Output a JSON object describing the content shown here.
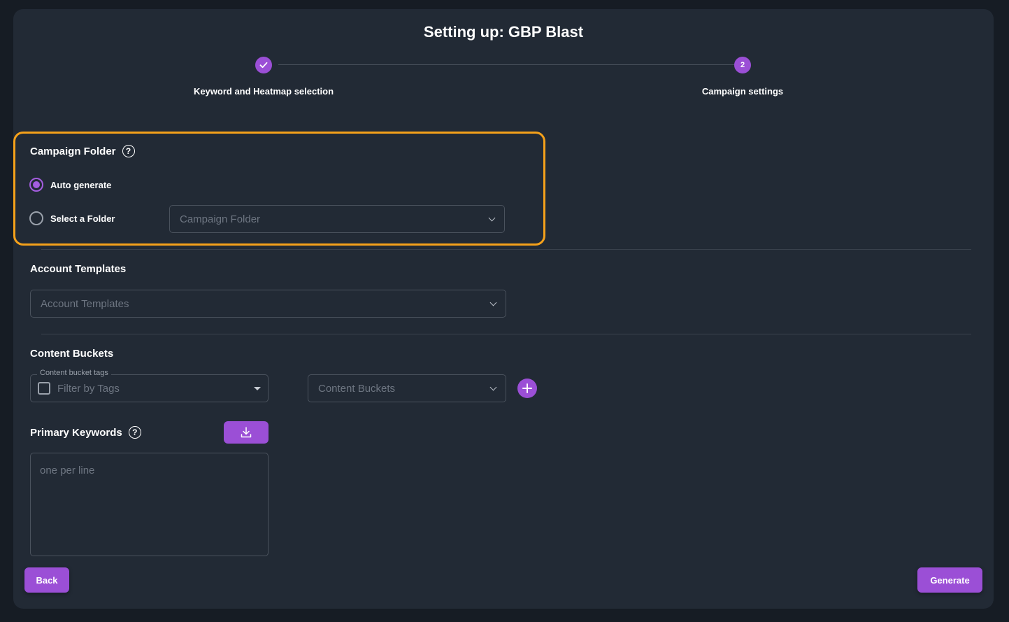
{
  "page": {
    "title": "Setting up: GBP Blast"
  },
  "stepper": {
    "steps": [
      {
        "label": "Keyword and Heatmap selection",
        "status": "completed",
        "icon": "check-icon"
      },
      {
        "label": "Campaign settings",
        "number": "2",
        "status": "active"
      }
    ]
  },
  "campaign_folder": {
    "title": "Campaign Folder",
    "options": [
      {
        "label": "Auto generate",
        "selected": true
      },
      {
        "label": "Select a Folder",
        "selected": false
      }
    ],
    "select_placeholder": "Campaign Folder"
  },
  "account_templates": {
    "title": "Account Templates",
    "select_placeholder": "Account Templates"
  },
  "content_buckets": {
    "title": "Content Buckets",
    "tags_legend": "Content bucket tags",
    "tags_placeholder": "Filter by Tags",
    "select_placeholder": "Content Buckets"
  },
  "primary_keywords": {
    "title": "Primary Keywords",
    "placeholder": "one per line"
  },
  "footer": {
    "back_label": "Back",
    "generate_label": "Generate"
  },
  "colors": {
    "accent": "#9b4fd6",
    "highlight": "#f5a11a",
    "panel": "#222a35",
    "background": "#161c24"
  }
}
